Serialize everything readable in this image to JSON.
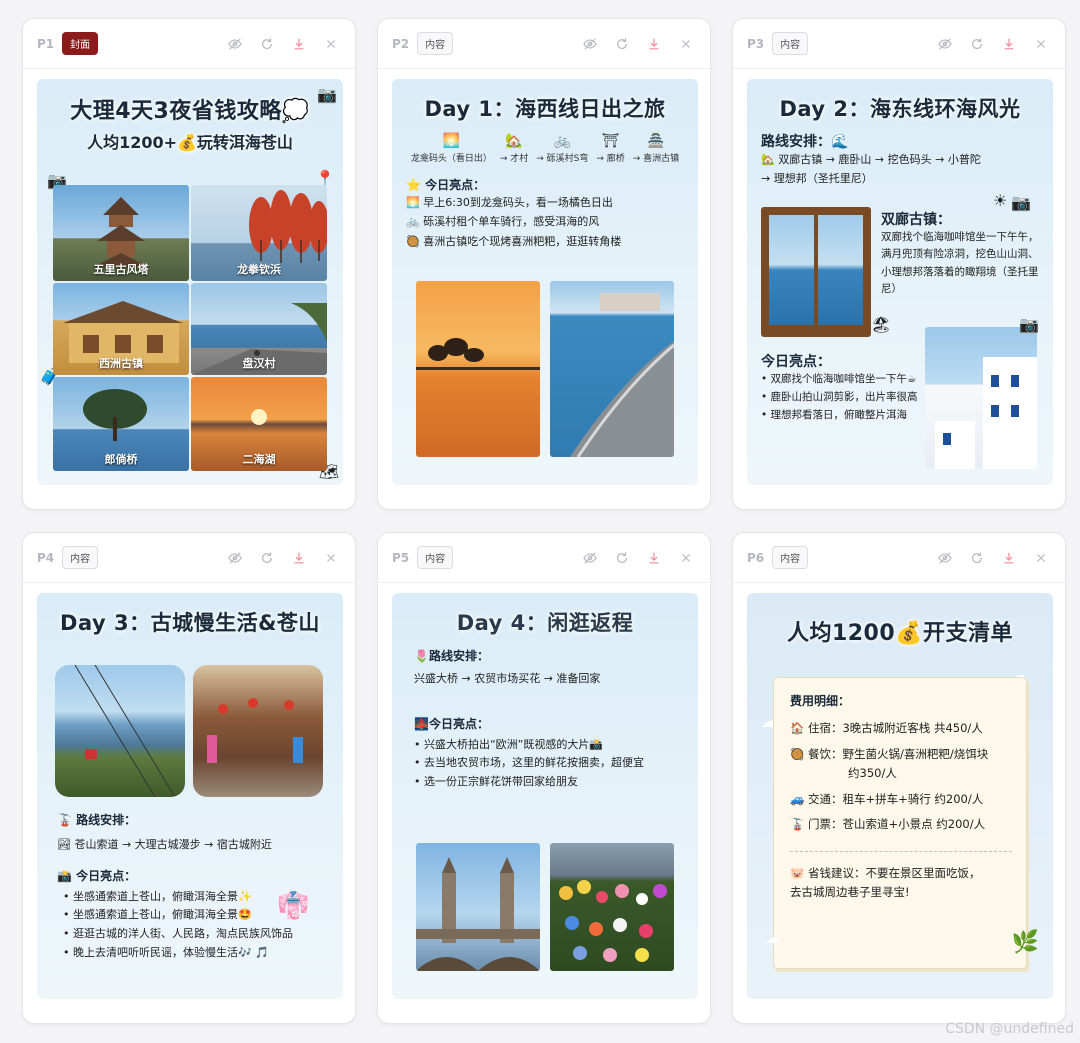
{
  "pages": [
    {
      "num": "P1",
      "badge": "封面"
    },
    {
      "num": "P2",
      "badge": "内容"
    },
    {
      "num": "P3",
      "badge": "内容"
    },
    {
      "num": "P4",
      "badge": "内容"
    },
    {
      "num": "P5",
      "badge": "内容"
    },
    {
      "num": "P6",
      "badge": "内容"
    }
  ],
  "header_icons": [
    "eye-off-icon",
    "refresh-icon",
    "download-icon",
    "close-icon"
  ],
  "p1": {
    "title": "大理4天3夜省钱攻略💭",
    "subtitle": "人均1200+💰玩转洱海苍山",
    "photos": [
      "五里古风塔",
      "龙拳钦浜",
      "西洲古镇",
      "盘汉村",
      "郎倘桥",
      "二海湖"
    ]
  },
  "p2": {
    "title": "Day 1：海西线日出之旅",
    "route": [
      {
        "icon": "🌅",
        "label": "龙龛码头（看日出）"
      },
      {
        "icon": "🏡",
        "label": "→ 才村"
      },
      {
        "icon": "🚲",
        "label": "→ 砾溪村S弯"
      },
      {
        "icon": "⛩",
        "label": "→ 廊桥"
      },
      {
        "icon": "🏯",
        "label": "→ 喜洲古镇"
      }
    ],
    "highlights_title": "⭐ 今日亮点：",
    "highlights": [
      "🌅 早上6:30到龙龛码头，看一场橘色日出",
      "🚲 砾溪村租个单车骑行，感受洱海的风",
      "🥘 喜洲古镇吃个现烤喜洲粑粑，逛逛转角楼"
    ]
  },
  "p3": {
    "title": "Day 2：海东线环海风光",
    "route_title": "路线安排：🌊",
    "route_text_1": "🏡 双廊古镇 → 鹿卧山 → 挖色码头 → 小普陀",
    "route_text_2": "→ 理想邦（圣托里尼）",
    "town_title": "双廊古镇：",
    "town_desc": "双廊找个临海咖啡馆坐一下午午，满月兜顶有险凉洞，挖色山山洞、小理想邦落落着的瞰翔境（圣托里尼）",
    "highlights_title": "今日亮点：",
    "highlights": [
      "• 双廊找个临海咖啡馆坐一下午☕",
      "• 鹿卧山拍山洞剪影，出片率很高",
      "• 理想邦看落日，俯瞰整片洱海"
    ]
  },
  "p4": {
    "title": "Day 3：古城慢生活&苍山",
    "route_title": "🚡 路线安排：",
    "route_text": "🏞 苍山索道 → 大理古城漫步 → 宿古城附近",
    "highlights_title": "📸 今日亮点：",
    "highlights": [
      "• 坐感通索道上苍山，俯瞰洱海全景✨",
      "• 坐感通索道上苍山，俯瞰洱海全景🤩",
      "• 逛逛古城的洋人街、人民路，淘点民族风饰品",
      "• 晚上去清吧听听民谣，体验慢生活🎶 🎵"
    ]
  },
  "p5": {
    "title": "Day 4：闲逛返程",
    "route_title": "🌷路线安排：",
    "route_text": "兴盛大桥 → 农贸市场买花 → 准备回家",
    "highlights_title": "🌉今日亮点：",
    "highlights": [
      "• 兴盛大桥拍出“欧洲”既视感的大片📸",
      "• 去当地农贸市场，这里的鲜花按捆卖，超便宜",
      "• 选一份正宗鲜花饼带回家给朋友"
    ]
  },
  "p6": {
    "title": "人均1200💰开支清单",
    "detail_title": "费用明细：",
    "items": [
      "🏠 住宿：3晚古城附近客栈 共450/人",
      "🥘 餐饮：野生菌火锅/喜洲粑粑/烧饵块",
      "约350/人",
      "🚙 交通：租车+拼车+骑行 约200/人",
      "🚡 门票：苍山索道+小景点 约200/人"
    ],
    "tip_1": "🐷 省钱建议：不要在景区里面吃饭，",
    "tip_2": "去古城周边巷子里寻宝!"
  },
  "watermark": "CSDN @undefined",
  "colors": {
    "cover_badge": "#8b1a1a",
    "poster_bg": "#d9ecf7",
    "title_text": "#1b2a3a"
  }
}
